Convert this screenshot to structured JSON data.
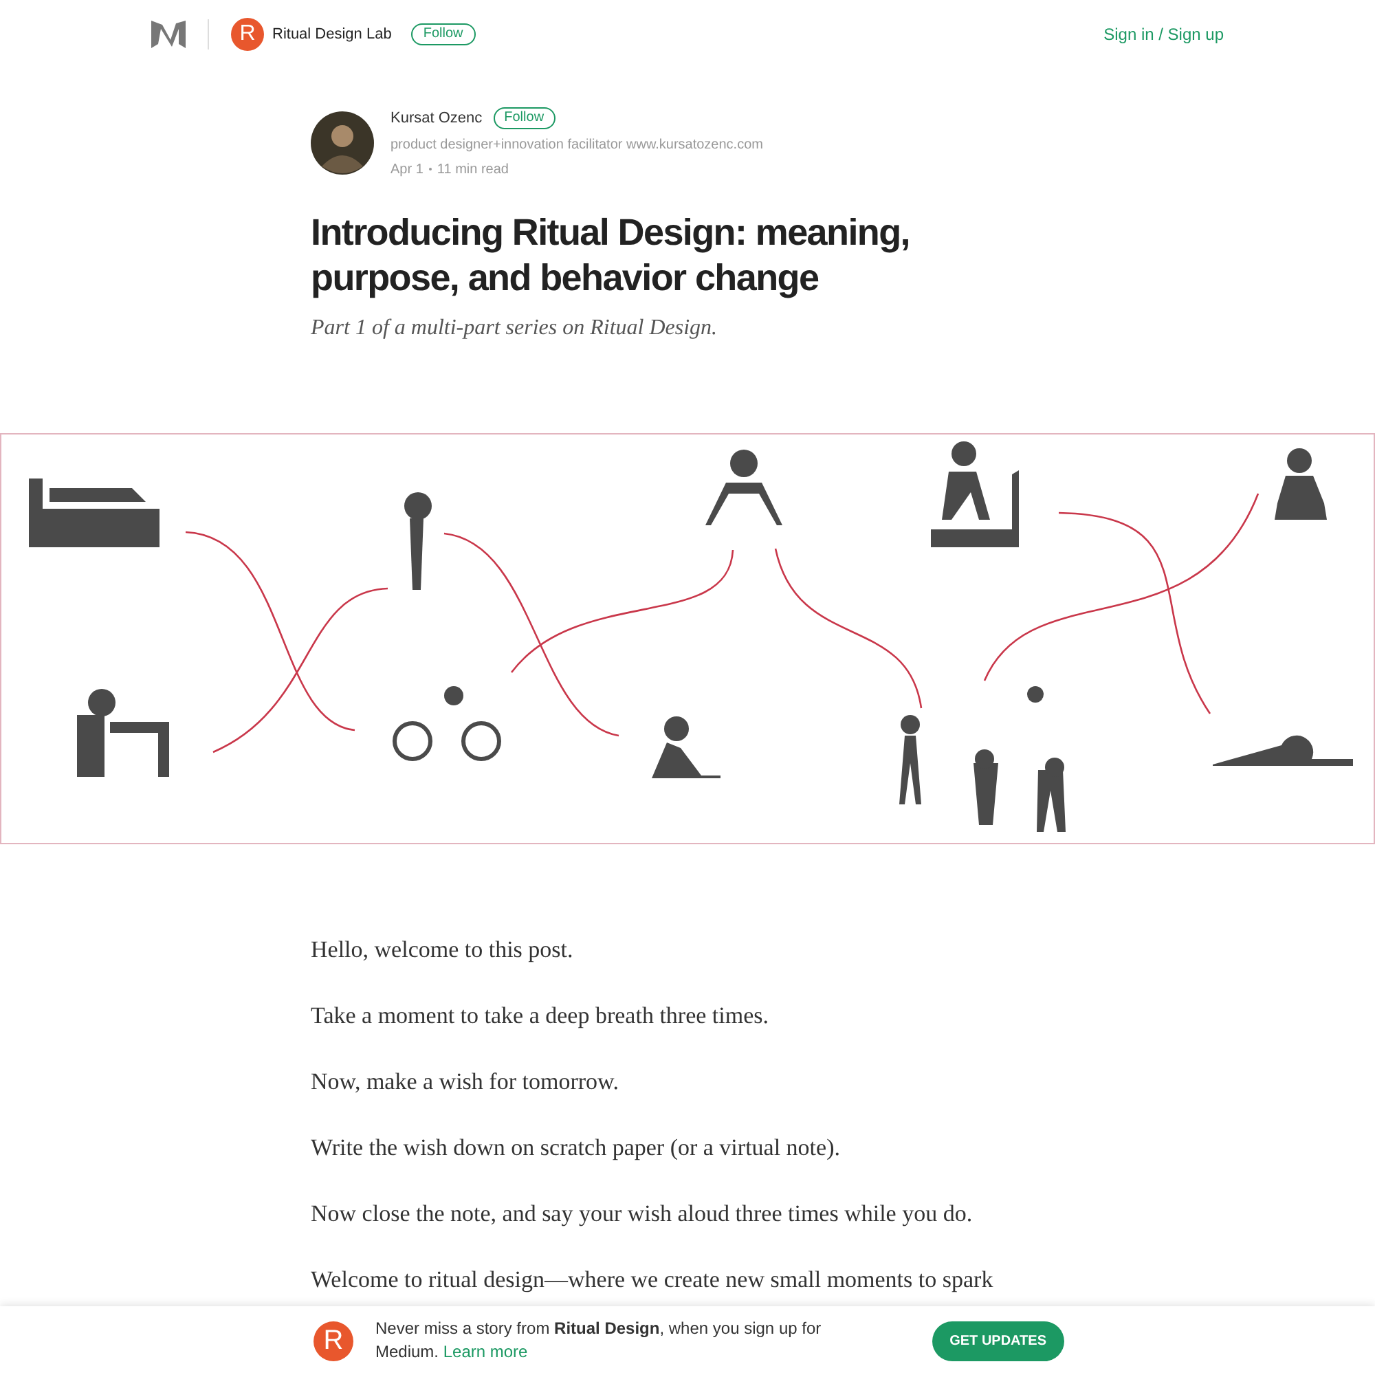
{
  "header": {
    "publication": {
      "initial": "R",
      "name": "Ritual Design Lab",
      "follow": "Follow"
    },
    "sign_in": "Sign in / Sign up"
  },
  "author": {
    "name": "Kursat Ozenc",
    "follow": "Follow",
    "bio": "product designer+innovation facilitator www.kursatozenc.com",
    "date": "Apr 1",
    "read_time": "11 min read"
  },
  "article": {
    "title": "Introducing Ritual Design: meaning, purpose, and behavior change",
    "subtitle": "Part 1 of a multi-part series on Ritual Design.",
    "paragraphs": [
      "Hello, welcome to this post.",
      "Take a moment to take a deep breath three times.",
      "Now, make a wish for tomorrow.",
      "Write the wish down on scratch paper (or a virtual note).",
      "Now close the note, and say your wish aloud three times while you do.",
      "Welcome to ritual design—where we create new small moments to spark"
    ]
  },
  "banner": {
    "initial": "R",
    "message": "Never miss a story from **Ritual Design**, when you sign up for Medium.",
    "link": "Learn more",
    "button": "GET UPDATES"
  }
}
